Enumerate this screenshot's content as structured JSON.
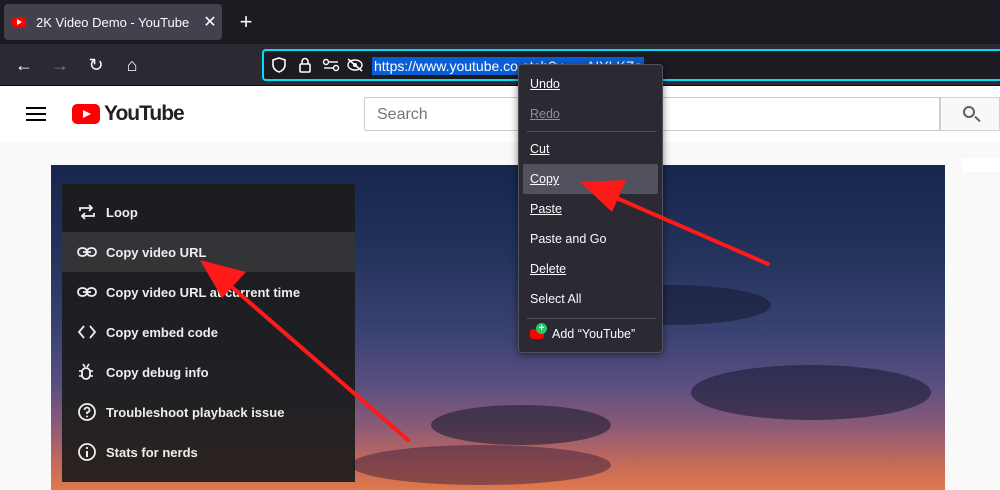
{
  "browser": {
    "tab_title": "2K Video Demo - YouTube",
    "tab_close": "✕",
    "new_tab": "+",
    "url": "https://www.youtube.com/watch?v=...AIYLKZo",
    "url_display": "https://www.youtube.co      atch?v=...    AIYLKZo"
  },
  "youtube": {
    "logo_text": "YouTube",
    "search_placeholder": "Search"
  },
  "yt_context_menu": {
    "items": [
      {
        "label": "Loop",
        "icon": "loop-icon"
      },
      {
        "label": "Copy video URL",
        "icon": "link-icon"
      },
      {
        "label": "Copy video URL at current time",
        "icon": "link-icon"
      },
      {
        "label": "Copy embed code",
        "icon": "code-icon"
      },
      {
        "label": "Copy debug info",
        "icon": "bug-icon"
      },
      {
        "label": "Troubleshoot playback issue",
        "icon": "question-icon"
      },
      {
        "label": "Stats for nerds",
        "icon": "info-icon"
      }
    ]
  },
  "ff_context_menu": {
    "undo": "Undo",
    "redo": "Redo",
    "cut": "Cut",
    "copy": "Copy",
    "paste": "Paste",
    "paste_and_go": "Paste and Go",
    "delete": "Delete",
    "select_all": "Select All",
    "add_search": "Add “YouTube”"
  },
  "colors": {
    "url_focus": "#00ddff",
    "selection": "#0a5fd6",
    "arrow": "#ff1a1a",
    "youtube_red": "#ff0000"
  }
}
